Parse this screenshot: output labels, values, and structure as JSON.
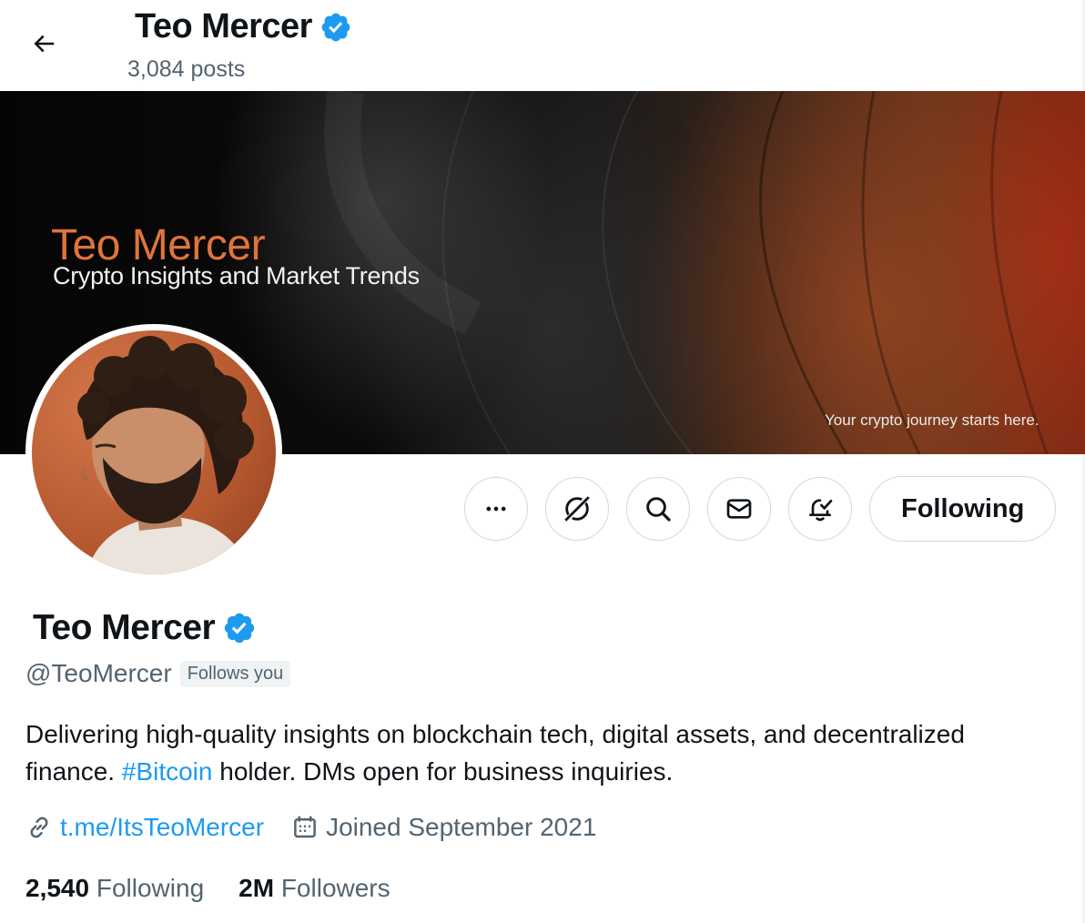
{
  "header": {
    "name": "Teo Mercer",
    "posts": "3,084 posts"
  },
  "banner": {
    "title": "Teo Mercer",
    "subtitle": "Crypto Insights and Market Trends",
    "tagline": "Your crypto journey starts here."
  },
  "actions": {
    "more_icon": "more-icon",
    "grok_icon": "grok-icon",
    "search_icon": "search-icon",
    "message_icon": "mail-icon",
    "notify_icon": "bell-check-icon",
    "following_label": "Following"
  },
  "profile": {
    "name": "Teo Mercer",
    "handle": "@TeoMercer",
    "follows_you": "Follows you",
    "bio_before": "Delivering high-quality insights on blockchain tech, digital assets, and decentralized finance. ",
    "bio_hashtag": "#Bitcoin",
    "bio_after": " holder. DMs open for business inquiries.",
    "link": "t.me/ItsTeoMercer",
    "joined": "Joined September 2021",
    "following_count": "2,540",
    "following_label": "Following",
    "followers_count": "2M",
    "followers_label": "Followers"
  },
  "colors": {
    "accent": "#1d9bf0",
    "verified": "#1d9bf0",
    "secondary_text": "#536471",
    "banner_title": "#e0743c"
  }
}
